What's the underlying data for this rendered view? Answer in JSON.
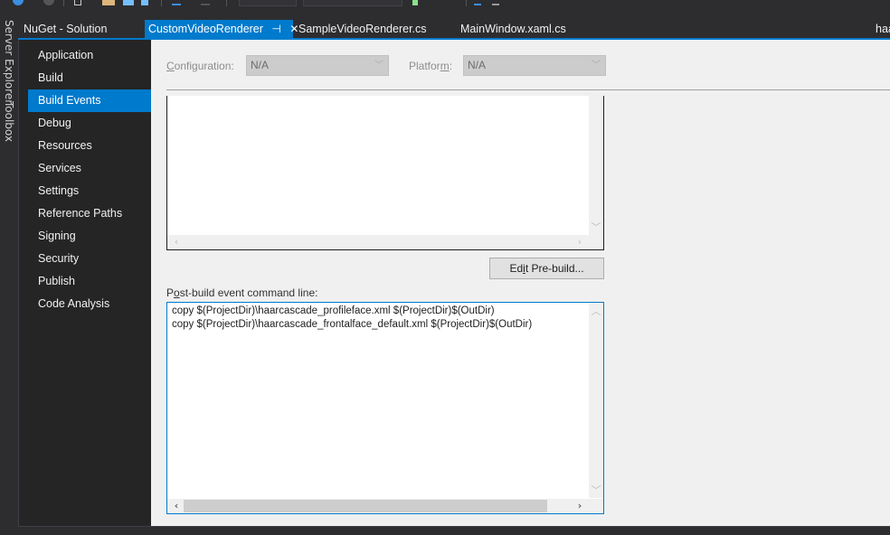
{
  "side_strip": {
    "server_explorer": "Server Explorer",
    "toolbox": "Toolbox"
  },
  "tabs": {
    "nuget": "NuGet - Solution",
    "active": "CustomVideoRenderer",
    "pin_glyph": "⊣",
    "close_glyph": "✕",
    "sample": "SampleVideoRenderer.cs",
    "mainwindow": "MainWindow.xaml.cs",
    "overflow": "haa"
  },
  "nav": {
    "items": [
      {
        "label": "Application"
      },
      {
        "label": "Build"
      },
      {
        "label": "Build Events",
        "selected": true
      },
      {
        "label": "Debug"
      },
      {
        "label": "Resources"
      },
      {
        "label": "Services"
      },
      {
        "label": "Settings"
      },
      {
        "label": "Reference Paths"
      },
      {
        "label": "Signing"
      },
      {
        "label": "Security"
      },
      {
        "label": "Publish"
      },
      {
        "label": "Code Analysis"
      }
    ]
  },
  "config": {
    "configuration_label_mn": "C",
    "configuration_label_rest": "onfiguration:",
    "configuration_value": "N/A",
    "platform_label_a": "Platfor",
    "platform_label_mn": "m",
    "platform_label_b": ":",
    "platform_value": "N/A",
    "chevron": "﹀"
  },
  "prebuild": {
    "edit_button_a": "Ed",
    "edit_button_mn": "i",
    "edit_button_b": "t Pre-build..."
  },
  "postbuild": {
    "label_a": "P",
    "label_mn": "o",
    "label_b": "st-build event command line:",
    "lines": [
      "copy $(ProjectDir)\\haarcascade_profileface.xml $(ProjectDir)$(OutDir)",
      "copy $(ProjectDir)\\haarcascade_frontalface_default.xml $(ProjectDir)$(OutDir)"
    ]
  },
  "scroll": {
    "up": "︿",
    "down": "﹀",
    "left": "‹",
    "right": "›"
  },
  "colors": {
    "accent": "#007acc",
    "ide_background": "#2d2d30",
    "nav_background": "#252526",
    "content_background": "#f0f0f0"
  }
}
